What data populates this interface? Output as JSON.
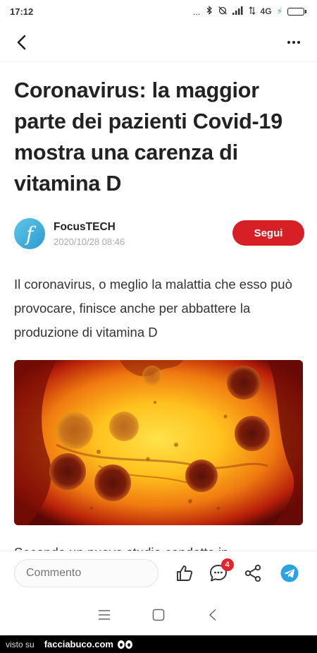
{
  "status_bar": {
    "time": "17:12",
    "dots": "...",
    "network": "4G",
    "colors": {
      "battery": "#27c24c"
    }
  },
  "app_bar": {
    "back_icon": "chevron-left-icon",
    "more_icon": "more-horizontal-icon"
  },
  "article": {
    "title": "Coronavirus: la maggior parte dei pazienti Covid-19 mostra una carenza di vitamina D",
    "author": {
      "avatar_letter": "f",
      "name": "FocusTECH",
      "date": "2020/10/28 08:46"
    },
    "follow_label": "Segui",
    "lead": "Il coronavirus, o meglio la malattia che esso può provocare, finisce anche per abbattere la produzione di vitamina D",
    "body_preview": "Secondo un nuovo studio condotto in"
  },
  "comment_bar": {
    "placeholder": "Commento",
    "comment_count": "4",
    "icons": [
      "thumbs-up-icon",
      "comment-icon",
      "share-icon",
      "telegram-icon"
    ]
  },
  "nav_bar": {
    "icons": [
      "menu-icon",
      "home-square-icon",
      "back-triangle-icon"
    ]
  },
  "watermark": {
    "prefix": "visto su",
    "site": "facciabuco.com"
  },
  "colors": {
    "accent": "#d71f26",
    "badge": "#e5232a",
    "telegram": "#2aa3e0",
    "avatar": "#2a9bd1"
  }
}
